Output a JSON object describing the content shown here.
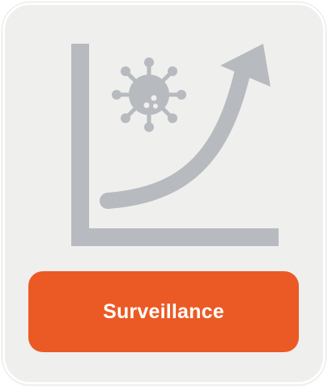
{
  "card": {
    "label": "Surveillance",
    "icon": "virus-growth-chart-icon"
  },
  "colors": {
    "card_background": "#efefee",
    "icon_gray": "#b7babe",
    "accent_orange": "#eb5a25",
    "label_text": "#ffffff"
  }
}
